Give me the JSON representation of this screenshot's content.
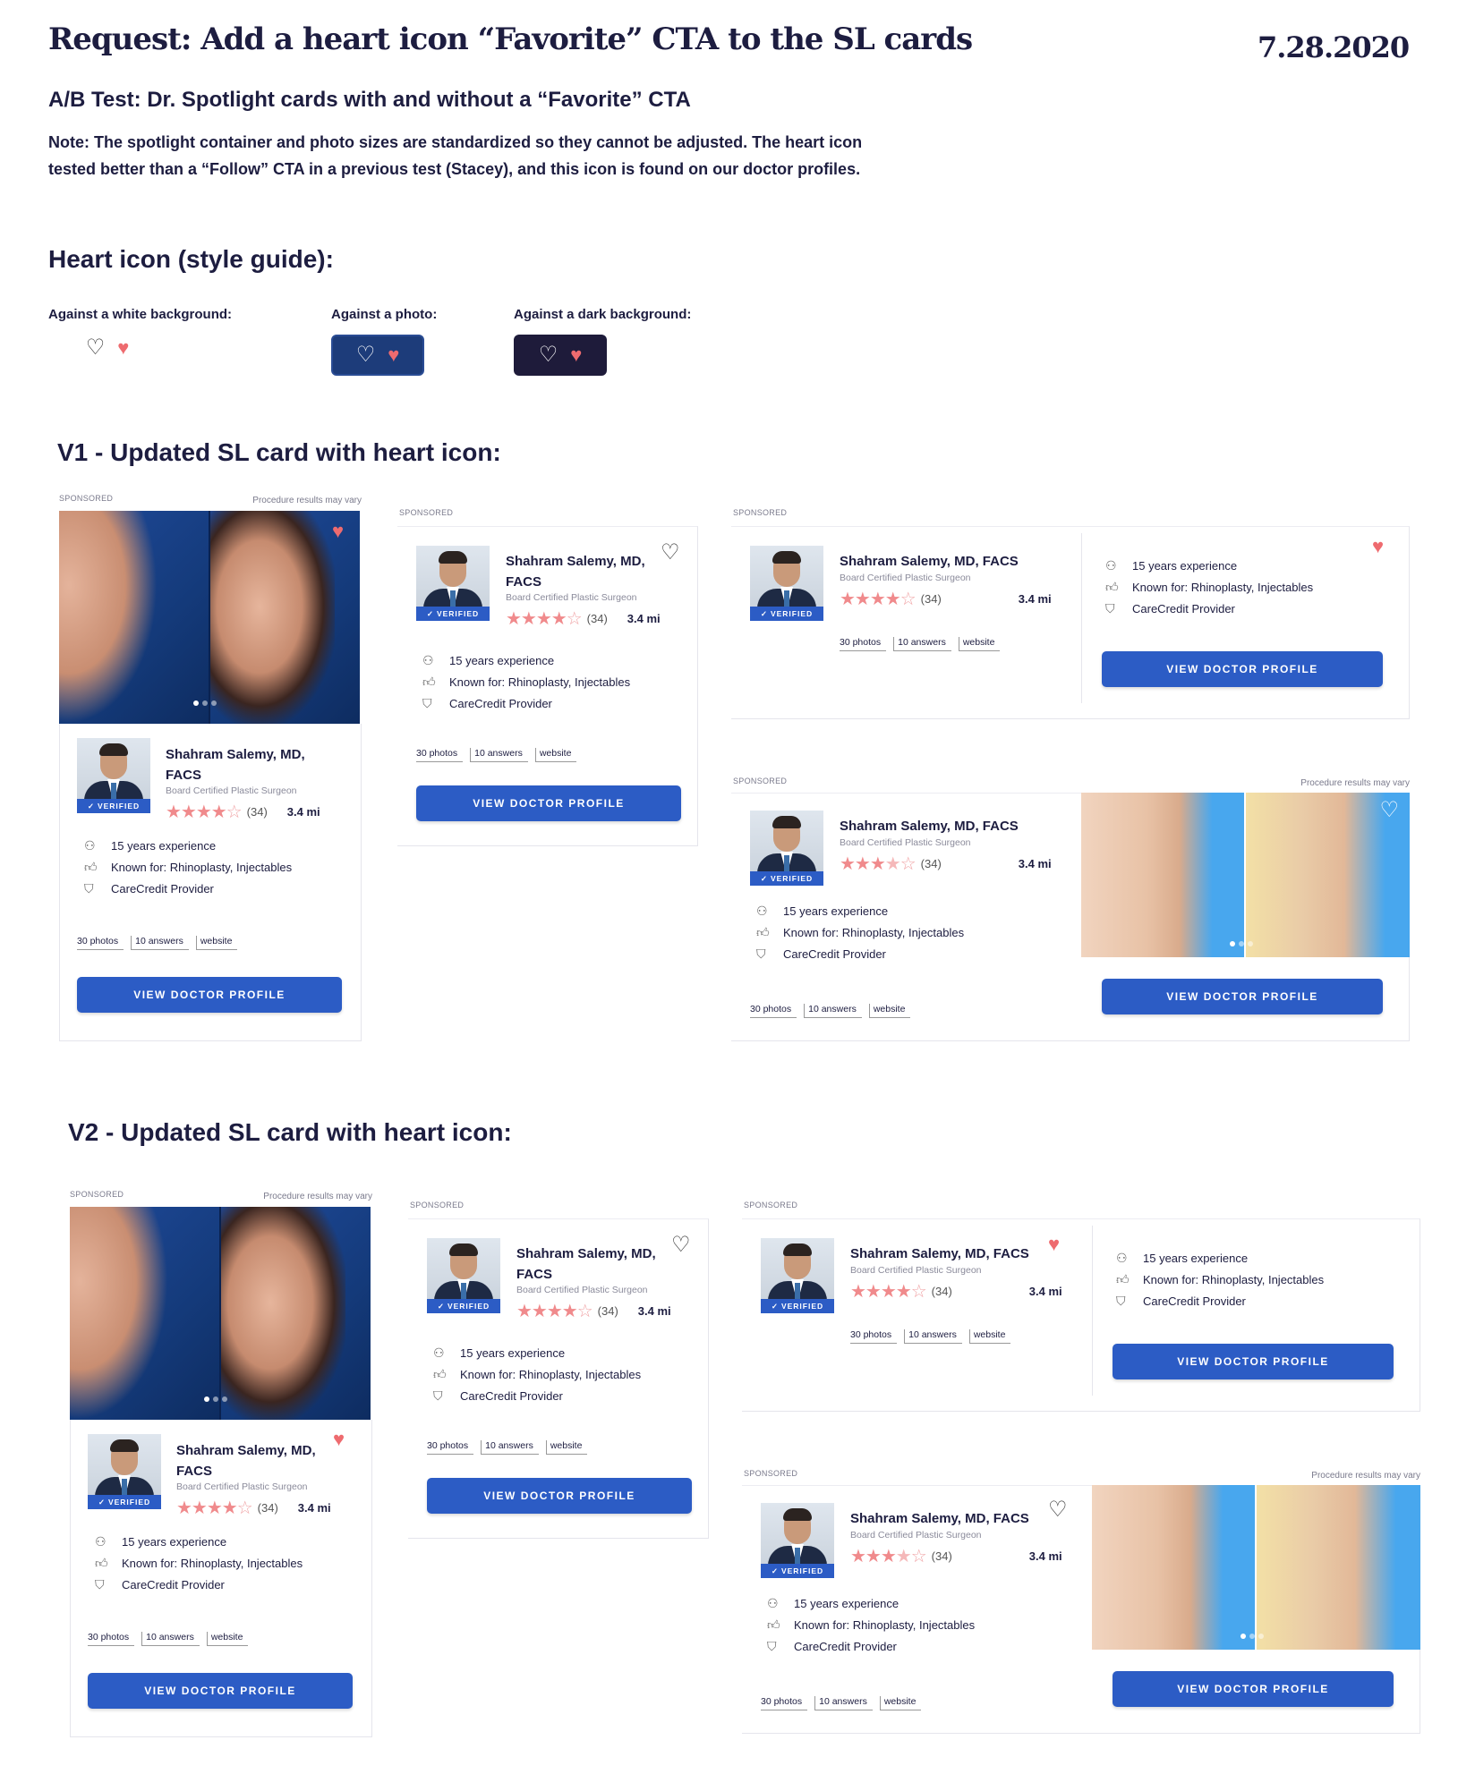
{
  "header": {
    "title": "Request: Add a heart icon “Favorite” CTA to the SL cards",
    "date": "7.28.2020",
    "subtitle": "A/B Test: Dr. Spotlight cards with and without a “Favorite” CTA",
    "note_line1": "Note: The spotlight container and photo sizes are standardized so they cannot be adjusted. The heart icon",
    "note_line2": "tested better than a “Follow” CTA in a previous test (Stacey), and this icon is found on our doctor profiles."
  },
  "style_guide": {
    "title": "Heart icon (style guide):",
    "white_label": "Against a white background:",
    "photo_label": "Against a photo:",
    "dark_label": "Against a dark background:"
  },
  "v1_title": "V1 - Updated SL card with heart icon:",
  "v2_title": "V2 - Updated SL card with heart icon:",
  "card": {
    "sponsored": "SPONSORED",
    "vary": "Procedure results may vary",
    "name_line1": "Shahram Salemy, MD,",
    "name_line2": "FACS",
    "name_full": "Shahram Salemy, MD, FACS",
    "specialty": "Board Certified Plastic Surgeon",
    "verified": "VERIFIED",
    "reviews": "(34)",
    "distance": "3.4 mi",
    "experience": "15 years experience",
    "known_label": "Known for:",
    "known_value": "Rhinoplasty, Injectables",
    "carecredit": "CareCredit Provider",
    "photos": "30 photos",
    "answers": "10 answers",
    "website": "website",
    "cta": "VIEW DOCTOR PROFILE"
  },
  "colors": {
    "primary": "#2c5cc5",
    "heart": "#ee6b6f",
    "navy": "#1d3c7a",
    "dark": "#1e1b3a"
  },
  "icons": [
    "heart-outline-icon",
    "heart-filled-icon",
    "person-icon",
    "thumbs-up-icon",
    "shield-check-icon",
    "check-icon",
    "star-icon"
  ]
}
